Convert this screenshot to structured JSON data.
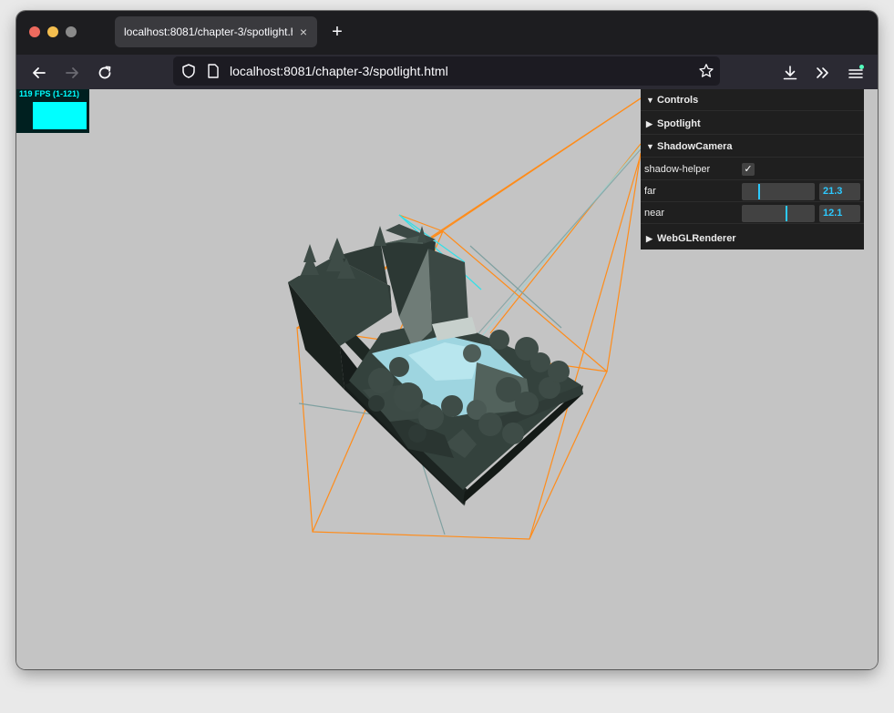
{
  "browser": {
    "tab_title": "localhost:8081/chapter-3/spotlight.h",
    "tab_close_glyph": "×",
    "new_tab_glyph": "+",
    "url": "localhost:8081/chapter-3/spotlight.html",
    "icons": [
      "back-icon",
      "forward-icon",
      "reload-icon",
      "shield-icon",
      "page-icon",
      "star-icon",
      "download-icon",
      "overflow-icon",
      "menu-icon"
    ]
  },
  "stats": {
    "fps_text": "119 FPS (1-121)"
  },
  "gui": {
    "controls_label": "Controls",
    "spotlight_label": "Spotlight",
    "shadowcamera_label": "ShadowCamera",
    "shadow_helper_label": "shadow-helper",
    "shadow_helper_checked": true,
    "far_label": "far",
    "far_value": "21.3",
    "far_fraction": 0.22,
    "near_label": "near",
    "near_value": "12.1",
    "near_fraction": 0.6,
    "webgl_label": "WebGLRenderer",
    "accent": "#2cc9ff"
  },
  "scene": {
    "background": "#c4c4c4",
    "frustum_color": "#ff8c1a",
    "helper_color": "#5fa0a0"
  }
}
